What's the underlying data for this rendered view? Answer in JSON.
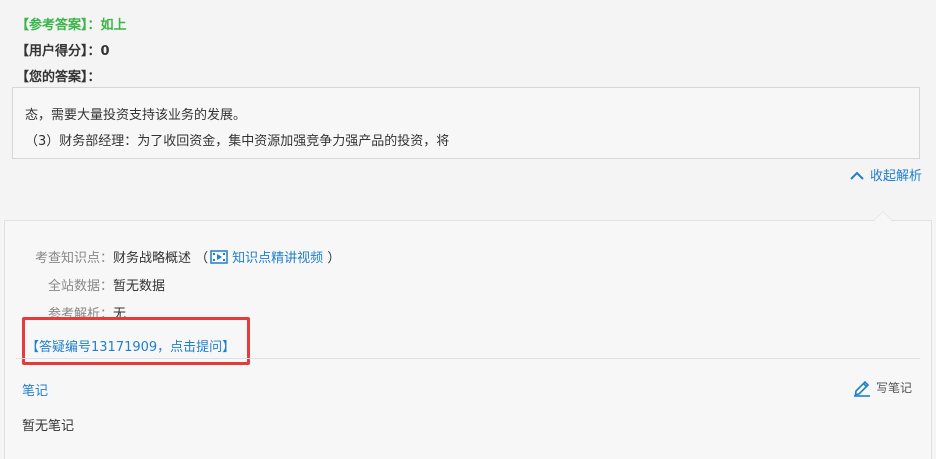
{
  "header": {
    "ref_answer_label": "【参考答案】：",
    "ref_answer_value": "如上",
    "user_score_label": "【用户得分】：",
    "user_score_value": "0",
    "your_answer_label": "【您的答案】："
  },
  "answer": {
    "line1": "态，需要大量投资支持该业务的发展。",
    "line2": "（3）财务部经理：为了收回资金，集中资源加强竞争力强产品的投资，将"
  },
  "collapse_label": "收起解析",
  "analysis": {
    "knowledge_label": "考查知识点：",
    "knowledge_value": "财务战略概述",
    "paren_open": "（",
    "video_link": "知识点精讲视频",
    "paren_close": "）",
    "site_data_label": "全站数据：",
    "site_data_value": "暂无数据",
    "ref_analysis_label": "参考解析：",
    "ref_analysis_value": "无",
    "qa_link": "【答疑编号13171909，点击提问】"
  },
  "notes": {
    "title": "笔记",
    "write_label": "写笔记",
    "empty": "暂无笔记"
  },
  "colors": {
    "accent": "#1f7fcf",
    "green": "#3bb54a",
    "highlight": "#e53b3b"
  }
}
